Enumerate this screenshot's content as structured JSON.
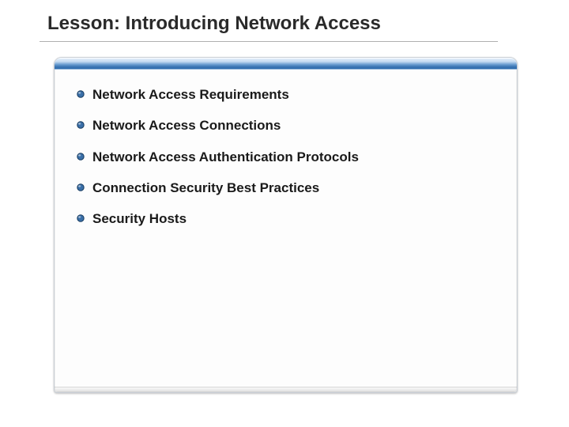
{
  "title": "Lesson: Introducing Network Access",
  "bullets": [
    {
      "text": "Network Access Requirements"
    },
    {
      "text": "Network Access Connections"
    },
    {
      "text": "Network Access Authentication Protocols"
    },
    {
      "text": "Connection Security Best Practices"
    },
    {
      "text": "Security Hosts"
    }
  ],
  "colors": {
    "bullet_fill": "#3a6fa8",
    "bullet_edge": "#163a5e"
  }
}
